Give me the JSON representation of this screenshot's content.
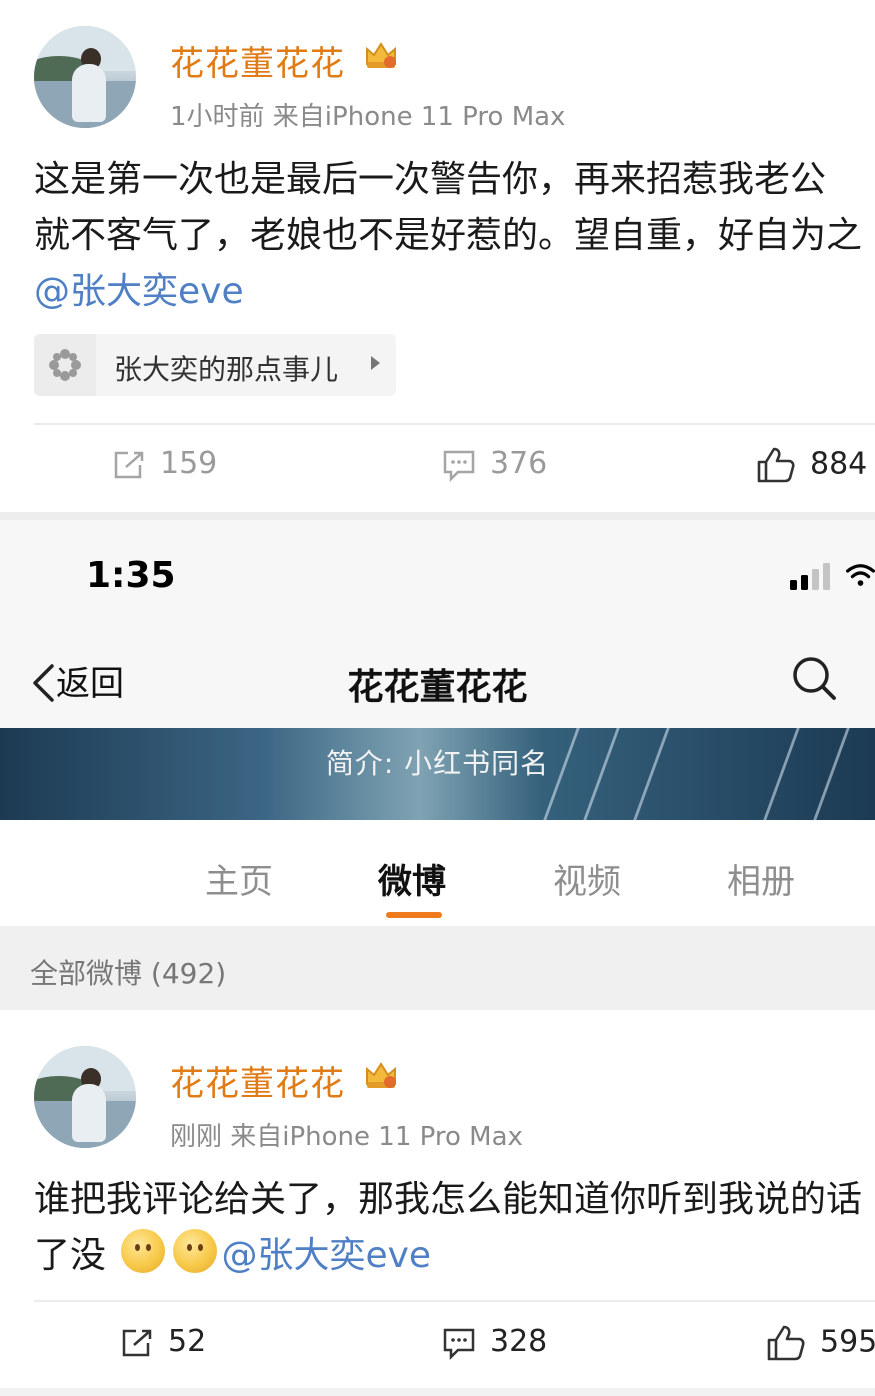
{
  "post1": {
    "username": "花花董花花",
    "meta": "1小时前  来自iPhone 11 Pro Max",
    "line1": "这是第一次也是最后一次警告你，再来招惹我老公",
    "line2": "就不客气了，老娘也不是好惹的。望自重，好自为之",
    "mention": "@张大奕eve",
    "topic": "张大奕的那点事儿",
    "actions": {
      "repost": "159",
      "comment": "376",
      "like": "884"
    }
  },
  "status": {
    "time": "1:35"
  },
  "navbar": {
    "back_label": "返回",
    "title": "花花董花花"
  },
  "banner": {
    "intro": "简介: 小红书同名"
  },
  "tabs": [
    {
      "label": "主页"
    },
    {
      "label": "微博"
    },
    {
      "label": "视频"
    },
    {
      "label": "相册"
    }
  ],
  "all_posts": "全部微博 (492)",
  "post2": {
    "username": "花花董花花",
    "meta": "刚刚  来自iPhone 11 Pro Max",
    "line1": "谁把我评论给关了，那我怎么能知道你听到我说的话",
    "line2_prefix": "了没",
    "mention": "@张大奕eve",
    "actions": {
      "repost": "52",
      "comment": "328",
      "like": "595"
    }
  },
  "colors": {
    "username": "#e07b16",
    "mention": "#4f7fc4",
    "tab_accent": "#f07b1e"
  },
  "icons": [
    "crown-badge-icon",
    "topic-icon",
    "repost-icon",
    "comment-icon",
    "like-icon",
    "back-chevron-icon",
    "search-icon",
    "signal-icon",
    "wifi-icon",
    "smile-emoji-icon"
  ]
}
